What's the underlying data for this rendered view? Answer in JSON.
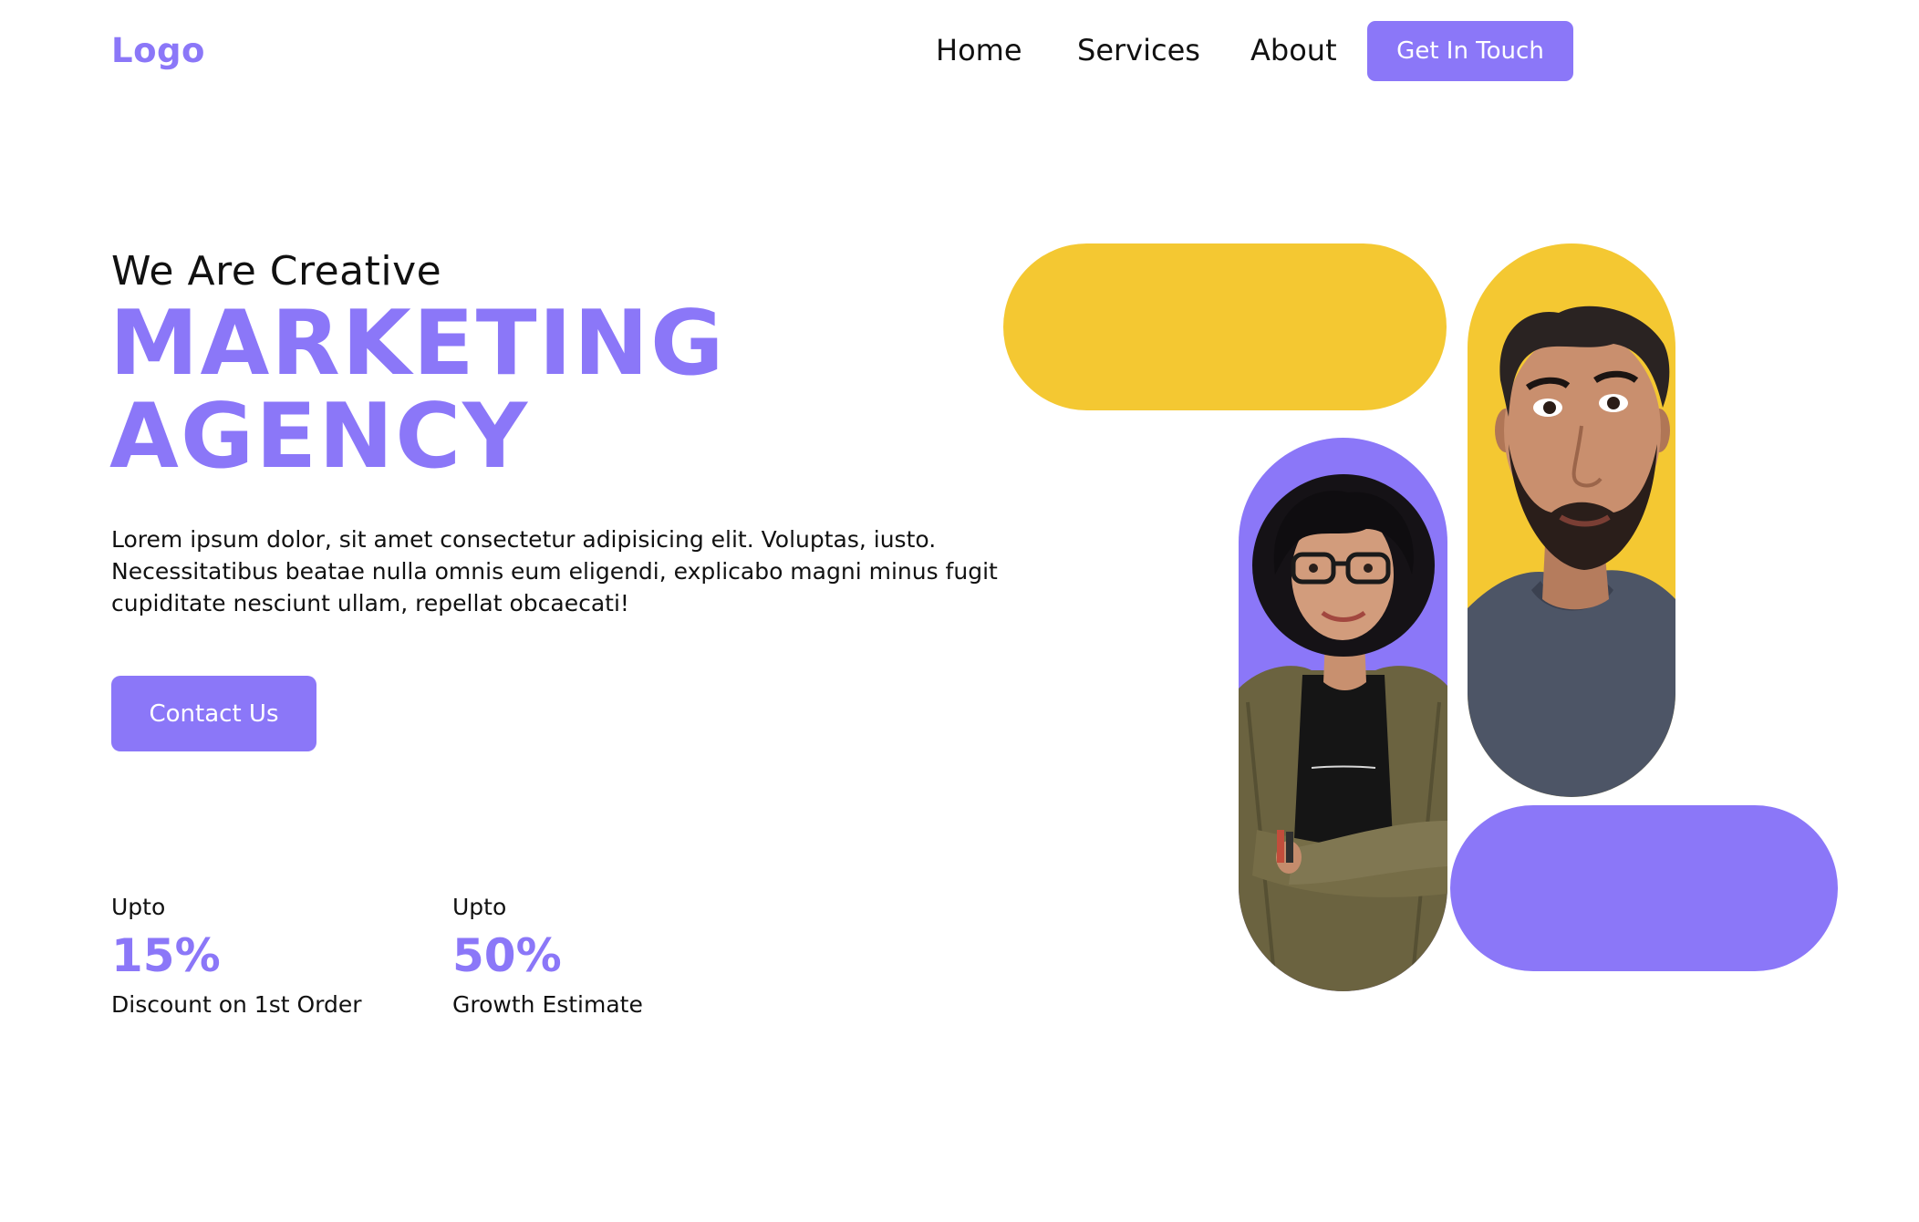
{
  "header": {
    "logo": "Logo",
    "nav": [
      {
        "label": "Home"
      },
      {
        "label": "Services"
      },
      {
        "label": "About"
      }
    ],
    "cta_label": "Get In Touch"
  },
  "hero": {
    "eyebrow": "We Are Creative",
    "headline_line1": "MARKETING",
    "headline_line2": "AGENCY",
    "intro": "Lorem ipsum dolor, sit amet consectetur adipisicing elit. Voluptas, iusto. Necessitatibus beatae nulla omnis eum eligendi, explicabo magni minus fugit cupiditate nesciunt ullam, repellat obcaecati!",
    "cta_label": "Contact Us"
  },
  "stats": [
    {
      "prefix": "Upto",
      "value": "15%",
      "caption": "Discount on 1st Order"
    },
    {
      "prefix": "Upto",
      "value": "50%",
      "caption": "Growth Estimate"
    }
  ],
  "colors": {
    "accent": "#8b77f8",
    "yellow": "#f4c832",
    "text": "#111111",
    "background": "#ffffff"
  },
  "icons": {
    "person_1": "woman-portrait-photo",
    "person_2": "man-portrait-photo"
  }
}
